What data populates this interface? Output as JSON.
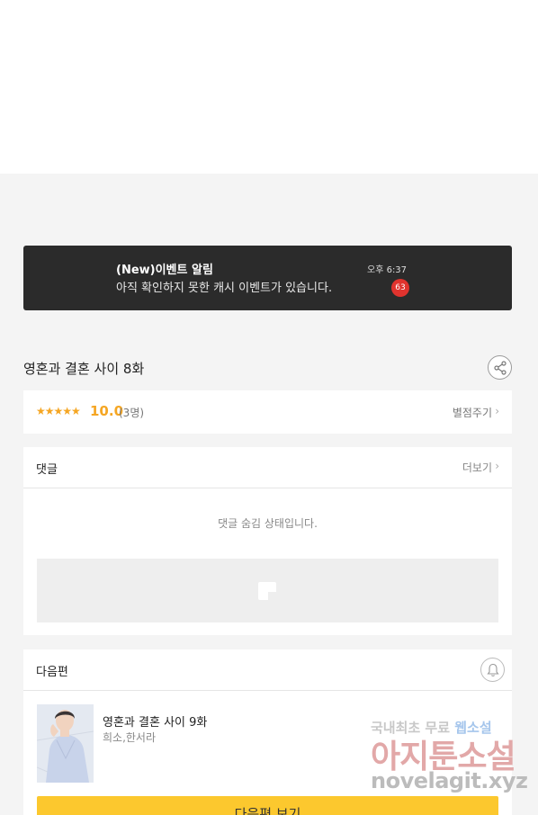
{
  "notice": {
    "title": "(New)이벤트 알림",
    "message": "아직 확인하지 못한 캐시 이벤트가 있습니다.",
    "time": "오후 6:37",
    "badge": "63"
  },
  "episode": {
    "title": "영혼과 결혼 사이 8화"
  },
  "rating": {
    "stars": "★★★★★",
    "score": "10.0",
    "count": "(3명)",
    "rate_link": "별점주기"
  },
  "comments": {
    "label": "댓글",
    "more": "더보기",
    "hidden_message": "댓글 숨김 상태입니다."
  },
  "next": {
    "label": "다음편",
    "title": "영혼과 결혼 사이 9화",
    "author": "희소,한서라",
    "button": "다음편 보기"
  },
  "watermark": {
    "line1_a": "국내최초 무료 ",
    "line1_b": "웹소설",
    "line2": "아지툰소설",
    "line3": "novelagit.xyz"
  },
  "icons": {
    "share": "share-icon",
    "bell": "bell-icon",
    "chevron": "chevron-right-icon"
  },
  "colors": {
    "accent_yellow": "#fcc82e",
    "star_orange": "#f5a623",
    "notice_bg": "#2b2b2b",
    "badge_red": "#e0332e"
  }
}
